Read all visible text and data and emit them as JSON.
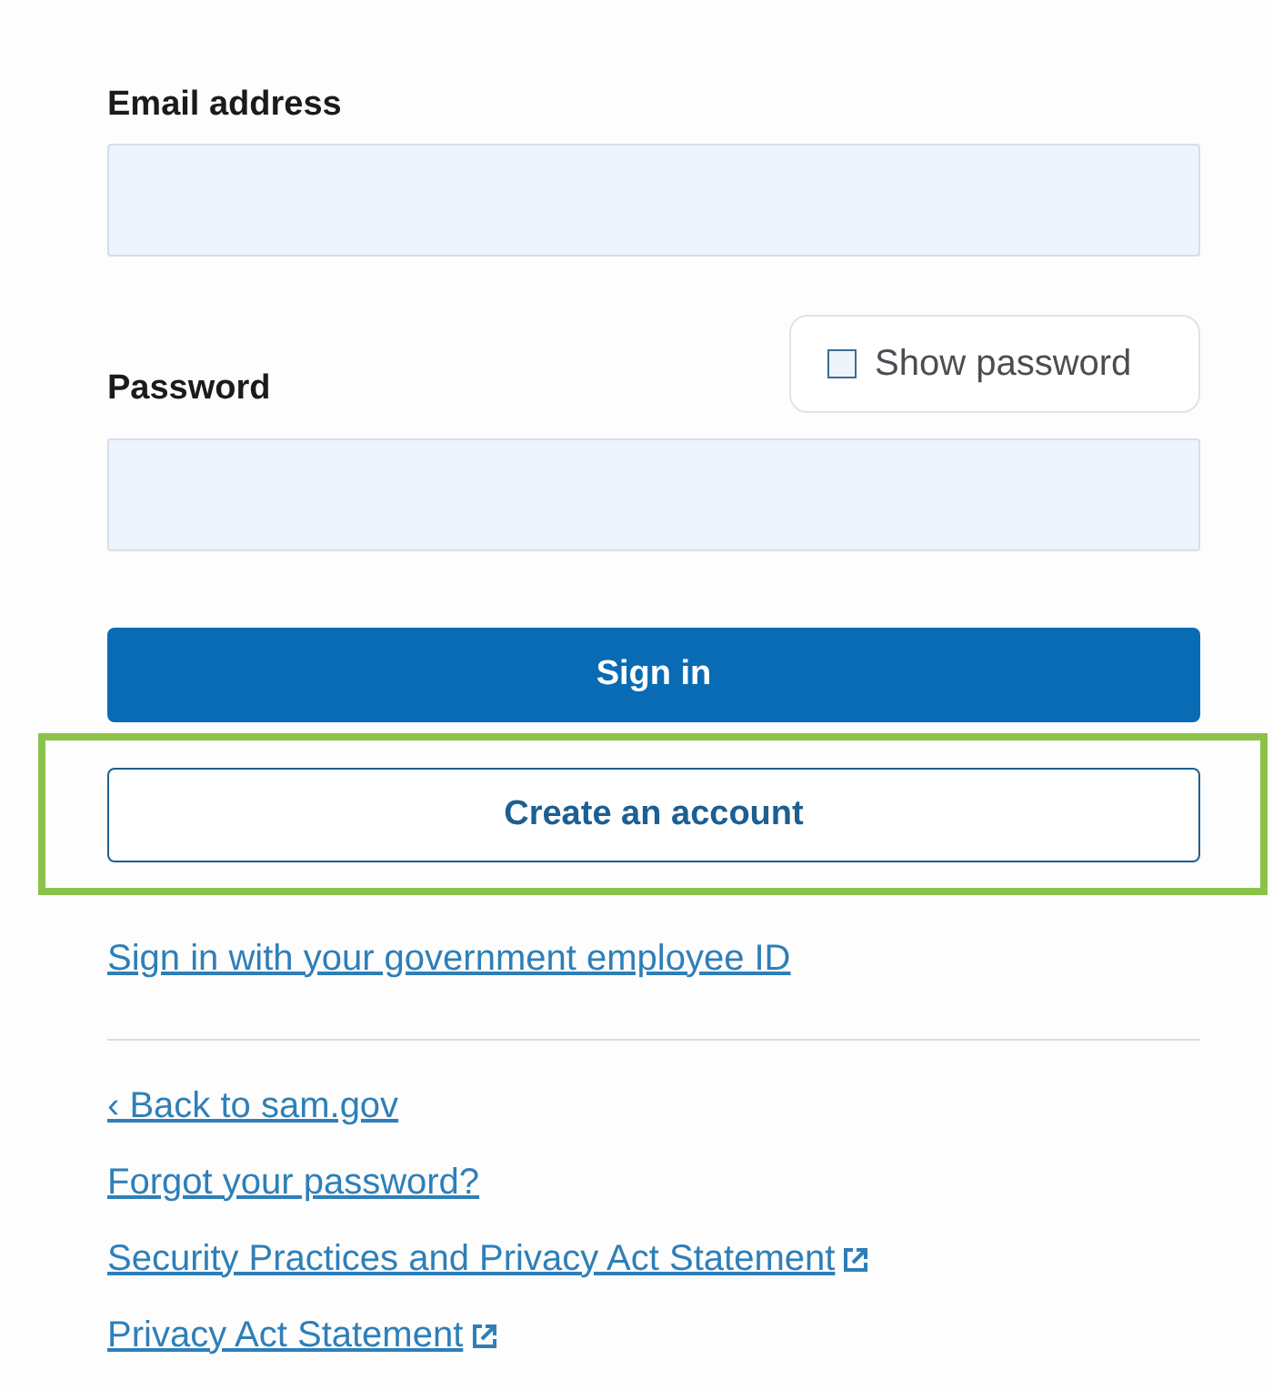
{
  "email": {
    "label": "Email address"
  },
  "show_password": {
    "label": "Show password",
    "checked": false
  },
  "password": {
    "label": "Password"
  },
  "sign_in": {
    "label": "Sign in"
  },
  "create_account": {
    "label": "Create an account",
    "highlighted": true
  },
  "gov_id_link": "Sign in with your government employee ID",
  "links": [
    {
      "text": "‹ Back to sam.gov",
      "external": false
    },
    {
      "text": "Forgot your password?",
      "external": false
    },
    {
      "text": "Security Practices and Privacy Act Statement",
      "external": true
    },
    {
      "text": "Privacy Act Statement",
      "external": true
    }
  ]
}
